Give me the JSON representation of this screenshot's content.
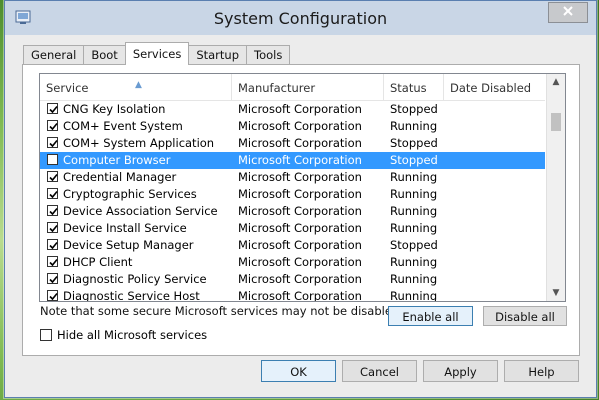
{
  "window": {
    "title": "System Configuration"
  },
  "tabs": [
    {
      "label": "General",
      "active": false
    },
    {
      "label": "Boot",
      "active": false
    },
    {
      "label": "Services",
      "active": true
    },
    {
      "label": "Startup",
      "active": false
    },
    {
      "label": "Tools",
      "active": false
    }
  ],
  "services_table": {
    "columns": [
      "Service",
      "Manufacturer",
      "Status",
      "Date Disabled"
    ],
    "rows": [
      {
        "checked": true,
        "name": "CNG Key Isolation",
        "manufacturer": "Microsoft Corporation",
        "status": "Stopped"
      },
      {
        "checked": true,
        "name": "COM+ Event System",
        "manufacturer": "Microsoft Corporation",
        "status": "Running"
      },
      {
        "checked": true,
        "name": "COM+ System Application",
        "manufacturer": "Microsoft Corporation",
        "status": "Stopped"
      },
      {
        "checked": false,
        "name": "Computer Browser",
        "manufacturer": "Microsoft Corporation",
        "status": "Stopped",
        "selected": true
      },
      {
        "checked": true,
        "name": "Credential Manager",
        "manufacturer": "Microsoft Corporation",
        "status": "Running"
      },
      {
        "checked": true,
        "name": "Cryptographic Services",
        "manufacturer": "Microsoft Corporation",
        "status": "Running"
      },
      {
        "checked": true,
        "name": "Device Association Service",
        "manufacturer": "Microsoft Corporation",
        "status": "Running"
      },
      {
        "checked": true,
        "name": "Device Install Service",
        "manufacturer": "Microsoft Corporation",
        "status": "Running"
      },
      {
        "checked": true,
        "name": "Device Setup Manager",
        "manufacturer": "Microsoft Corporation",
        "status": "Stopped"
      },
      {
        "checked": true,
        "name": "DHCP Client",
        "manufacturer": "Microsoft Corporation",
        "status": "Running"
      },
      {
        "checked": true,
        "name": "Diagnostic Policy Service",
        "manufacturer": "Microsoft Corporation",
        "status": "Running"
      },
      {
        "checked": true,
        "name": "Diagnostic Service Host",
        "manufacturer": "Microsoft Corporation",
        "status": "Running"
      }
    ]
  },
  "note": "Note that some secure Microsoft services may not be disabled.",
  "buttons": {
    "enable_all": "Enable all",
    "disable_all": "Disable all",
    "ok": "OK",
    "cancel": "Cancel",
    "apply": "Apply",
    "help": "Help"
  },
  "hide_microsoft": {
    "label": "Hide all Microsoft services",
    "checked": false
  },
  "colors": {
    "selection": "#3399ff",
    "titlebar": "#c9d6e6"
  }
}
